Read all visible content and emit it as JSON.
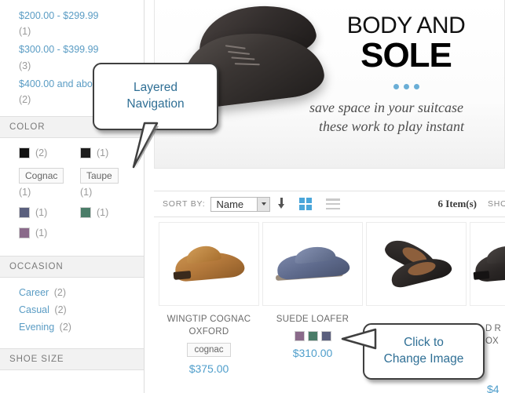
{
  "sidebar": {
    "price_filters": [
      {
        "label": "$200.00 - $299.99",
        "count": "(1)"
      },
      {
        "label": "$300.00 - $399.99",
        "count": "(3)"
      },
      {
        "label": "$400.00 and above",
        "count": "(2)"
      }
    ],
    "color_section": {
      "title": "COLOR",
      "swatches": [
        {
          "type": "swatch",
          "hex": "#111111",
          "count": "(2)"
        },
        {
          "type": "swatch",
          "hex": "#1d1d1d",
          "count": "(1)"
        },
        {
          "type": "label",
          "label": "Cognac",
          "count": "(1)"
        },
        {
          "type": "label",
          "label": "Taupe",
          "count": "(1)"
        },
        {
          "type": "swatch",
          "hex": "#5a5f7d",
          "count": "(1)"
        },
        {
          "type": "swatch",
          "hex": "#4a7c68",
          "count": "(1)"
        },
        {
          "type": "swatch",
          "hex": "#8a6a8a",
          "count": "(1)"
        }
      ]
    },
    "occasion_section": {
      "title": "OCCASION",
      "items": [
        {
          "label": "Career",
          "count": "(2)"
        },
        {
          "label": "Casual",
          "count": "(2)"
        },
        {
          "label": "Evening",
          "count": "(2)"
        }
      ]
    },
    "shoe_size_section": {
      "title": "SHOE SIZE"
    }
  },
  "banner": {
    "line1": "BODY AND",
    "line2": "SOLE",
    "subtitle_line1": "save space in your suitcase",
    "subtitle_line2": "these work to play instant",
    "dot_color": "#6aaed6"
  },
  "toolbar": {
    "sort_by_label": "SORT BY:",
    "sort_value": "Name",
    "sort_options": [
      "Name"
    ],
    "direction_icon": "arrow-down-icon",
    "grid_icon": "grid-view-icon",
    "list_icon": "list-view-icon",
    "item_count": "6 Item(s)",
    "show_label": "SHOW"
  },
  "products": [
    {
      "name": "WINGTIP COGNAC OXFORD",
      "swatch_label": "cognac",
      "price": "$375.00"
    },
    {
      "name": "SUEDE LOAFER",
      "swatches": [
        "#8a6a8a",
        "#4a7c68",
        "#5a5f7d"
      ],
      "price": "$310.00"
    },
    {
      "name": "",
      "price": ""
    }
  ],
  "partial_product": {
    "name_fragment": "D\nR\nOX",
    "price_fragment": "$4"
  },
  "callouts": [
    {
      "id": "layered-navigation",
      "text": "Layered\nNavigation"
    },
    {
      "id": "click-to-change-image",
      "text": "Click to\nChange Image"
    }
  ],
  "colors": {
    "link_blue": "#5a9cc4",
    "price_blue": "#4f9ecb",
    "accent_blue": "#4aa6da",
    "callout_text": "#2f6f95",
    "muted_gray": "#9a9a9a",
    "section_bg": "#f2f2f2"
  }
}
